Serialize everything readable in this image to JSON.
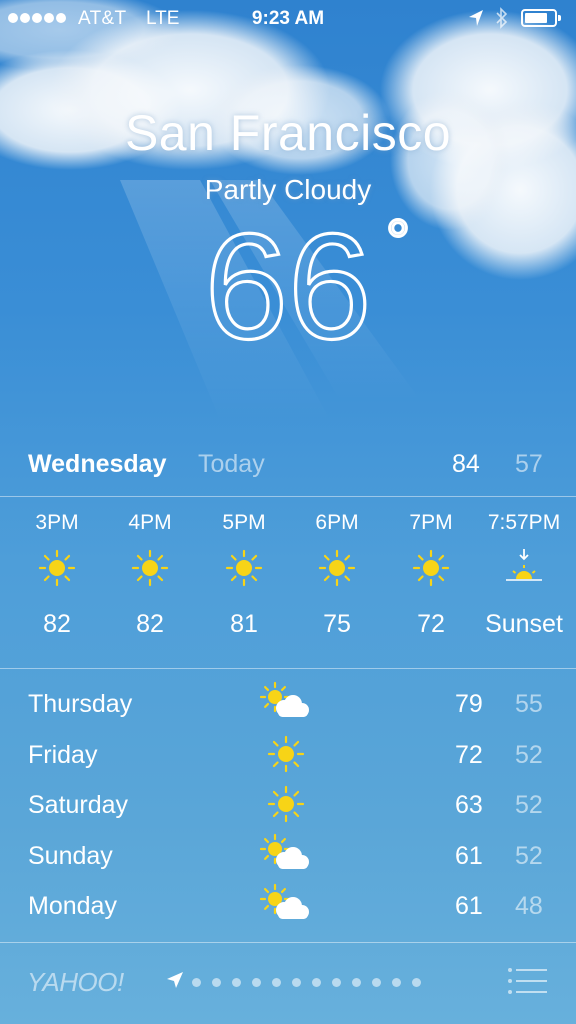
{
  "status_bar": {
    "carrier": "AT&T",
    "network": "LTE",
    "time": "9:23 AM",
    "signal_bars": 5,
    "battery_level": 0.8
  },
  "current": {
    "city": "San Francisco",
    "condition": "Partly Cloudy",
    "temperature": "66",
    "degree_symbol": "°"
  },
  "today": {
    "day": "Wednesday",
    "label": "Today",
    "high": "84",
    "low": "57"
  },
  "hourly": [
    {
      "time": "3PM",
      "icon": "sun-icon",
      "temp": "82"
    },
    {
      "time": "4PM",
      "icon": "sun-icon",
      "temp": "82"
    },
    {
      "time": "5PM",
      "icon": "sun-icon",
      "temp": "81"
    },
    {
      "time": "6PM",
      "icon": "sun-icon",
      "temp": "75"
    },
    {
      "time": "7PM",
      "icon": "sun-icon",
      "temp": "72"
    },
    {
      "time": "7:57PM",
      "icon": "sunset-icon",
      "temp": "Sunset"
    }
  ],
  "daily": [
    {
      "day": "Thursday",
      "icon": "partly-cloudy-icon",
      "high": "79",
      "low": "55"
    },
    {
      "day": "Friday",
      "icon": "sun-icon",
      "high": "72",
      "low": "52"
    },
    {
      "day": "Saturday",
      "icon": "sun-icon",
      "high": "63",
      "low": "52"
    },
    {
      "day": "Sunday",
      "icon": "partly-cloudy-icon",
      "high": "61",
      "low": "52"
    },
    {
      "day": "Monday",
      "icon": "partly-cloudy-icon",
      "high": "61",
      "low": "48"
    }
  ],
  "footer": {
    "brand": "YAHOO!",
    "page_dots": 12
  },
  "colors": {
    "sun": "#f7d417",
    "sky_top": "#2f82cf",
    "sky_bottom": "#67b0dc",
    "dim_text": "rgba(255,255,255,0.55)"
  }
}
